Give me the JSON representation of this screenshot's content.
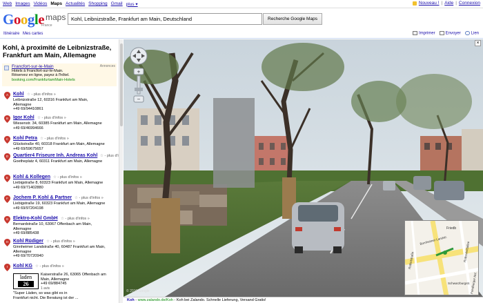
{
  "topnav": {
    "items": [
      "Web",
      "Images",
      "Vidéos",
      "Maps",
      "Actualités",
      "Shopping",
      "Gmail",
      "plus ▾"
    ],
    "active": "Maps",
    "right": {
      "new": "Nouveau !",
      "help": "Aide",
      "signin": "Connexion"
    }
  },
  "logo": {
    "google": "Google",
    "maps": "maps",
    "country": "France"
  },
  "search": {
    "value": "Kohl, Leibnizstraße, Frankfurt am Main, Deutschland",
    "button": "Recherche Google Maps"
  },
  "subbar": {
    "itinerary": "Itinéraire",
    "mymaps": "Mes cartes",
    "print": "Imprimer",
    "send": "Envoyer",
    "link": "Lien"
  },
  "place_title": "Kohl, à proximité de Leibnizstraße, Frankfurt am Main, Allemagne",
  "ad": {
    "label": "Annonces",
    "title": "Francfort-sur-le-Main",
    "line1": "Hotels à Francfort-sur-le-Main.",
    "line2": "Réservez en ligne, payez à l'hôtel.",
    "url": "booking.com/FrankfurtamMain-Hotels"
  },
  "results": [
    {
      "letter": "A",
      "name": "Kohl",
      "addr1": "Leibnizstraße 12, 60316 Frankfurt am Main,",
      "addr2": "Allemagne",
      "phone": "+49 69/94410861"
    },
    {
      "letter": "B",
      "name": "Igor Kohl",
      "addr1": "Wiesenstr. 34, 60385 Frankfurt am Main, Allemagne",
      "addr2": "",
      "phone": "+49 69/46994666"
    },
    {
      "letter": "C",
      "name": "Kohl Petra",
      "addr1": "Glückstraße 40, 60318 Frankfurt am Main, Allemagne",
      "addr2": "",
      "phone": "+49 69/59675657"
    },
    {
      "letter": "D",
      "name": "Quartier4 Friseure Inh. Andreas Kohl",
      "addr1": "Goetheplatz 4, 60311 Frankfurt am Main, Allemagne",
      "addr2": "",
      "phone": ""
    },
    {
      "letter": "E",
      "name": "Kohl & Kollegen",
      "addr1": "Liebigstraße 8, 60323 Frankfurt am Main, Allemagne",
      "addr2": "",
      "phone": "+49 69/71402880"
    },
    {
      "letter": "F",
      "name": "Jochem P. Kohl & Partner",
      "addr1": "Liebigstraße 19, 60323 Frankfurt am Main, Allemagne",
      "addr2": "",
      "phone": "+49 69/97204198"
    },
    {
      "letter": "G",
      "name": "Elektro-Kohl GmbH",
      "addr1": "Bernardstraße 10, 63067 Offenbach am Main,",
      "addr2": "Allemagne",
      "phone": "+49 69/885438"
    },
    {
      "letter": "H",
      "name": "Kohl Rüdiger",
      "addr1": "Ginnheimer Landstraße 40, 60487 Frankfurt am Main,",
      "addr2": "Allemagne",
      "phone": "+49 69/70720940"
    },
    {
      "letter": "I",
      "name": "Kohl KG",
      "addr1": "",
      "addr2": "",
      "phone": ""
    }
  ],
  "moreinfo": "- plus d'infos »",
  "kg": {
    "logo_line1": "laden",
    "logo_line2": "26",
    "addr1": "Kaiserstraße 26, 63065 Offenbach am",
    "addr2": "Main, Allemagne",
    "phone": "+49 69/884745",
    "avis": "1 avis",
    "quote1": "\"Super Läden, so was gibt es in",
    "quote2": "Frankfurt nicht. Die Beratung ist der ..."
  },
  "map": {
    "copyright": "© 2010 Google",
    "close": "×"
  },
  "minimap": {
    "labels": [
      "Friedb",
      "Rothschildallee",
      "Bornheimer Landstr.",
      "Rotlintstraße",
      "Schwarzburgstr.",
      "Friedberger Anl."
    ]
  },
  "adbar": {
    "brand": "Koh",
    "sep": " - ",
    "url": "www.zalando.de/Koh",
    "text": " - Koh bei Zalando. Schnelle Lieferung, Versand Gratis!"
  },
  "colors": {
    "pin": "#c8382f",
    "link": "#1a0dab",
    "url": "#0a8a0a"
  }
}
